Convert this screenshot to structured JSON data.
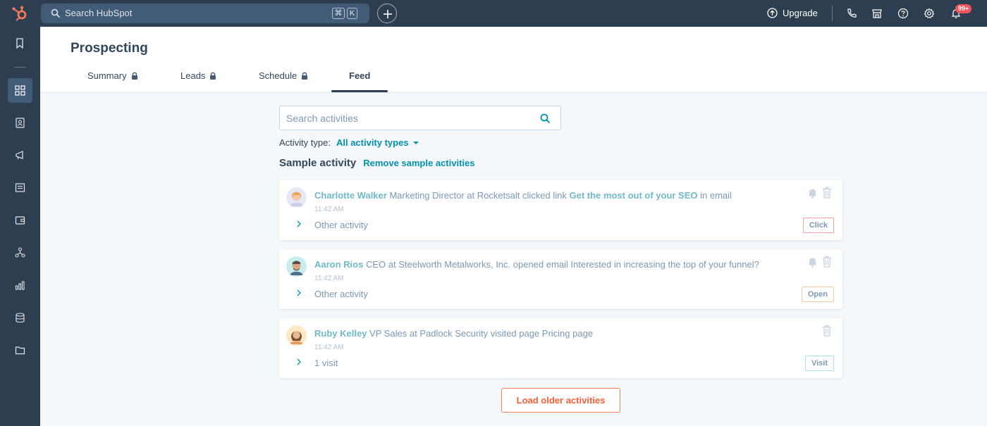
{
  "topbar": {
    "search_placeholder": "Search HubSpot",
    "kbd_cmd": "⌘",
    "kbd_k": "K",
    "upgrade_label": "Upgrade",
    "notification_badge": "99+"
  },
  "header": {
    "title": "Prospecting",
    "tabs": [
      {
        "label": "Summary",
        "locked": true
      },
      {
        "label": "Leads",
        "locked": true
      },
      {
        "label": "Schedule",
        "locked": true
      },
      {
        "label": "Feed",
        "locked": false,
        "active": true
      }
    ]
  },
  "feed": {
    "search_placeholder": "Search activities",
    "filter_label": "Activity type:",
    "filter_value": "All activity types",
    "sample_label": "Sample activity",
    "remove_sample_label": "Remove sample activities",
    "load_older_label": "Load older activities",
    "activities": [
      {
        "name": "Charlotte Walker",
        "text_before": "Marketing Director at Rocketsalt clicked link",
        "link": "Get the most out of your SEO",
        "text_after": "in email",
        "time": "11:42 AM",
        "detail": "Other activity",
        "tag": "Click",
        "has_bell": true
      },
      {
        "name": "Aaron Rios",
        "text_before": "CEO at Steelworth Metalworks, Inc. opened email Interested in increasing the top of your funnel?",
        "link": "",
        "text_after": "",
        "time": "11:42 AM",
        "detail": "Other activity",
        "tag": "Open",
        "has_bell": true
      },
      {
        "name": "Ruby Kelley",
        "text_before": "VP Sales at Padlock Security visited page Pricing page",
        "link": "",
        "text_after": "",
        "time": "11:42 AM",
        "detail": "1 visit",
        "tag": "Visit",
        "has_bell": false
      }
    ]
  },
  "colors": {
    "nav_bg": "#2d3e50",
    "search_bg": "#425b76",
    "accent_teal": "#0091ae",
    "accent_orange": "#ff7a59",
    "page_bg": "#f5f8fa"
  }
}
